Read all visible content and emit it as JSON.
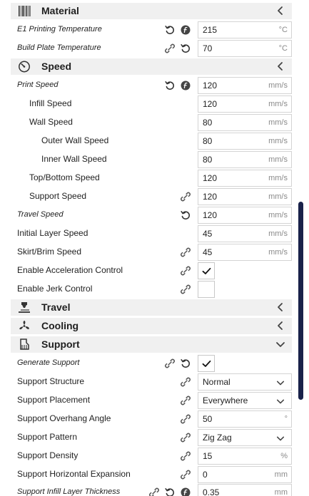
{
  "sections": {
    "material": {
      "title": "Material",
      "icon": "barcode-icon"
    },
    "speed": {
      "title": "Speed",
      "icon": "gauge-icon"
    },
    "travel": {
      "title": "Travel",
      "icon": "nozzle-icon"
    },
    "cooling": {
      "title": "Cooling",
      "icon": "fan-icon"
    },
    "support": {
      "title": "Support",
      "icon": "support-icon"
    }
  },
  "rows": [
    {
      "label": "E1 Printing Temperature",
      "value": "215",
      "unit": "°C"
    },
    {
      "label": "Build Plate Temperature",
      "value": "70",
      "unit": "°C"
    },
    {
      "label": "Print Speed",
      "value": "120",
      "unit": "mm/s"
    },
    {
      "label": "Infill Speed",
      "value": "120",
      "unit": "mm/s"
    },
    {
      "label": "Wall Speed",
      "value": "80",
      "unit": "mm/s"
    },
    {
      "label": "Outer Wall Speed",
      "value": "80",
      "unit": "mm/s"
    },
    {
      "label": "Inner Wall Speed",
      "value": "80",
      "unit": "mm/s"
    },
    {
      "label": "Top/Bottom Speed",
      "value": "120",
      "unit": "mm/s"
    },
    {
      "label": "Support Speed",
      "value": "120",
      "unit": "mm/s"
    },
    {
      "label": "Travel Speed",
      "value": "120",
      "unit": "mm/s"
    },
    {
      "label": "Initial Layer Speed",
      "value": "45",
      "unit": "mm/s"
    },
    {
      "label": "Skirt/Brim Speed",
      "value": "45",
      "unit": "mm/s"
    },
    {
      "label": "Enable Acceleration Control",
      "checked": true
    },
    {
      "label": "Enable Jerk Control",
      "checked": false
    },
    {
      "label": "Generate Support",
      "checked": true
    },
    {
      "label": "Support Structure",
      "value": "Normal"
    },
    {
      "label": "Support Placement",
      "value": "Everywhere"
    },
    {
      "label": "Support Overhang Angle",
      "value": "50",
      "unit": "°"
    },
    {
      "label": "Support Pattern",
      "value": "Zig Zag"
    },
    {
      "label": "Support Density",
      "value": "15",
      "unit": "%"
    },
    {
      "label": "Support Horizontal Expansion",
      "value": "0",
      "unit": "mm"
    },
    {
      "label": "Support Infill Layer Thickness",
      "value": "0.35",
      "unit": "mm"
    }
  ],
  "colors": {
    "section_bg": "#f0f0f0",
    "scrollbar": "#19224a",
    "field_border": "#d4d4d4",
    "unit_text": "#8a8a8a"
  }
}
